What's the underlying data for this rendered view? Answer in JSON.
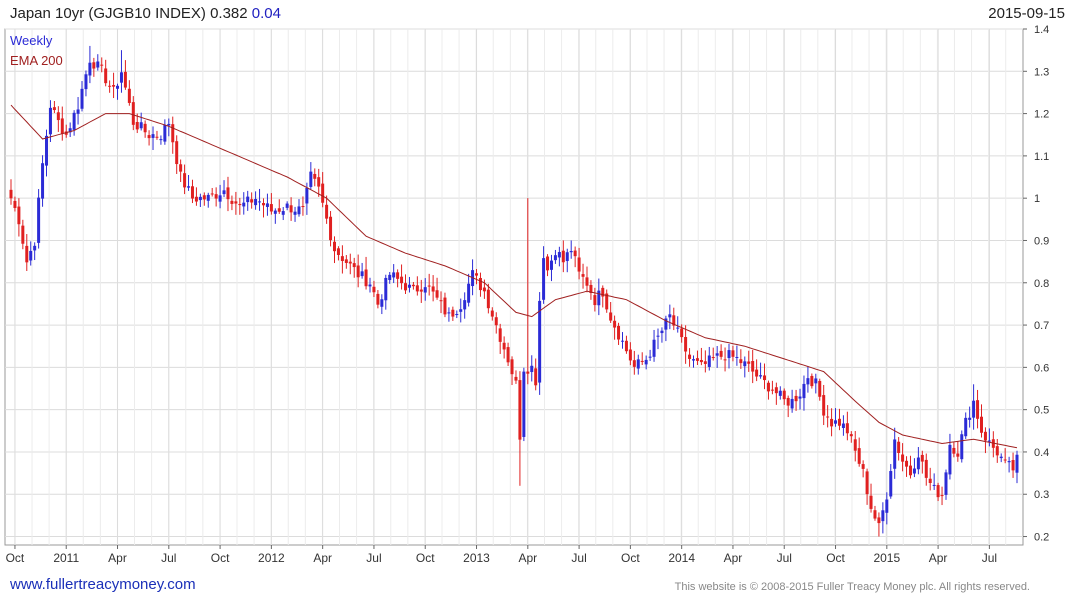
{
  "header": {
    "title": "Japan 10yr (GJGB10 INDEX) 0.382",
    "change": "0.04",
    "date": "2015-09-15"
  },
  "footer": {
    "url": "www.fullertreacymoney.com",
    "copyright": "This website is © 2008-2015 Fuller Treacy Money plc. All rights reserved."
  },
  "colors": {
    "up": "#2b2bd6",
    "down": "#e02020",
    "ema": "#a02020",
    "grid": "#dcdcdc"
  },
  "chart_data": {
    "type": "candlestick",
    "legend": [
      "Weekly",
      "EMA 200"
    ],
    "legend_position": "top-left",
    "y_axis": "right",
    "ylim": [
      0.18,
      1.4
    ],
    "y_ticks": [
      "0.2",
      "0.3",
      "0.4",
      "0.5",
      "0.6",
      "0.7",
      "0.8",
      "0.9",
      "1",
      "1.1",
      "1.2",
      "1.3",
      "1.4"
    ],
    "x_ticks": [
      "Oct",
      "2011",
      "Apr",
      "Jul",
      "Oct",
      "2012",
      "Apr",
      "Jul",
      "Oct",
      "2013",
      "Apr",
      "Jul",
      "Oct",
      "2014",
      "Apr",
      "Jul",
      "Oct",
      "2015",
      "Apr",
      "Jul"
    ],
    "x_tick_weeks": [
      1,
      14,
      27,
      40,
      53,
      66,
      79,
      92,
      105,
      118,
      131,
      144,
      157,
      170,
      183,
      196,
      209,
      222,
      235,
      248
    ],
    "weekly_close_anchors": [
      [
        0,
        1.0
      ],
      [
        2,
        0.95
      ],
      [
        4,
        0.85
      ],
      [
        6,
        0.9
      ],
      [
        8,
        1.08
      ],
      [
        10,
        1.22
      ],
      [
        12,
        1.18
      ],
      [
        14,
        1.15
      ],
      [
        17,
        1.22
      ],
      [
        20,
        1.33
      ],
      [
        23,
        1.3
      ],
      [
        26,
        1.25
      ],
      [
        28,
        1.3
      ],
      [
        31,
        1.18
      ],
      [
        35,
        1.15
      ],
      [
        38,
        1.15
      ],
      [
        40,
        1.18
      ],
      [
        43,
        1.05
      ],
      [
        46,
        1.0
      ],
      [
        50,
        1.0
      ],
      [
        54,
        1.02
      ],
      [
        58,
        0.98
      ],
      [
        62,
        1.0
      ],
      [
        66,
        0.97
      ],
      [
        70,
        0.98
      ],
      [
        74,
        0.97
      ],
      [
        76,
        1.05
      ],
      [
        78,
        1.02
      ],
      [
        80,
        0.95
      ],
      [
        82,
        0.88
      ],
      [
        85,
        0.85
      ],
      [
        88,
        0.82
      ],
      [
        91,
        0.8
      ],
      [
        93,
        0.75
      ],
      [
        96,
        0.82
      ],
      [
        99,
        0.8
      ],
      [
        102,
        0.78
      ],
      [
        105,
        0.8
      ],
      [
        108,
        0.76
      ],
      [
        111,
        0.72
      ],
      [
        114,
        0.75
      ],
      [
        117,
        0.82
      ],
      [
        120,
        0.78
      ],
      [
        123,
        0.7
      ],
      [
        126,
        0.62
      ],
      [
        128,
        0.56
      ],
      [
        129,
        0.44
      ],
      [
        130,
        0.6
      ],
      [
        132,
        0.6
      ],
      [
        133,
        0.57
      ],
      [
        134,
        0.76
      ],
      [
        135,
        0.87
      ],
      [
        136,
        0.83
      ],
      [
        138,
        0.88
      ],
      [
        140,
        0.85
      ],
      [
        142,
        0.88
      ],
      [
        144,
        0.82
      ],
      [
        146,
        0.8
      ],
      [
        148,
        0.76
      ],
      [
        150,
        0.78
      ],
      [
        152,
        0.72
      ],
      [
        154,
        0.68
      ],
      [
        156,
        0.64
      ],
      [
        158,
        0.6
      ],
      [
        161,
        0.62
      ],
      [
        164,
        0.67
      ],
      [
        167,
        0.72
      ],
      [
        169,
        0.68
      ],
      [
        172,
        0.62
      ],
      [
        175,
        0.6
      ],
      [
        178,
        0.62
      ],
      [
        181,
        0.63
      ],
      [
        184,
        0.62
      ],
      [
        187,
        0.6
      ],
      [
        190,
        0.57
      ],
      [
        193,
        0.55
      ],
      [
        196,
        0.52
      ],
      [
        198,
        0.52
      ],
      [
        200,
        0.54
      ],
      [
        202,
        0.58
      ],
      [
        204,
        0.56
      ],
      [
        206,
        0.5
      ],
      [
        208,
        0.47
      ],
      [
        210,
        0.47
      ],
      [
        212,
        0.45
      ],
      [
        214,
        0.4
      ],
      [
        216,
        0.35
      ],
      [
        218,
        0.27
      ],
      [
        220,
        0.22
      ],
      [
        222,
        0.3
      ],
      [
        224,
        0.43
      ],
      [
        226,
        0.38
      ],
      [
        228,
        0.35
      ],
      [
        230,
        0.4
      ],
      [
        232,
        0.34
      ],
      [
        234,
        0.31
      ],
      [
        236,
        0.3
      ],
      [
        238,
        0.42
      ],
      [
        240,
        0.4
      ],
      [
        242,
        0.47
      ],
      [
        244,
        0.52
      ],
      [
        246,
        0.45
      ],
      [
        248,
        0.42
      ],
      [
        250,
        0.4
      ],
      [
        252,
        0.37
      ],
      [
        254,
        0.36
      ],
      [
        255,
        0.38
      ]
    ],
    "ema200_anchors": [
      [
        0,
        1.22
      ],
      [
        8,
        1.14
      ],
      [
        16,
        1.16
      ],
      [
        24,
        1.2
      ],
      [
        30,
        1.2
      ],
      [
        40,
        1.17
      ],
      [
        50,
        1.13
      ],
      [
        60,
        1.09
      ],
      [
        70,
        1.05
      ],
      [
        80,
        1.0
      ],
      [
        90,
        0.91
      ],
      [
        100,
        0.87
      ],
      [
        110,
        0.84
      ],
      [
        120,
        0.8
      ],
      [
        128,
        0.73
      ],
      [
        132,
        0.72
      ],
      [
        138,
        0.76
      ],
      [
        146,
        0.78
      ],
      [
        156,
        0.76
      ],
      [
        166,
        0.71
      ],
      [
        176,
        0.67
      ],
      [
        186,
        0.65
      ],
      [
        196,
        0.62
      ],
      [
        206,
        0.59
      ],
      [
        214,
        0.52
      ],
      [
        220,
        0.47
      ],
      [
        226,
        0.44
      ],
      [
        236,
        0.42
      ],
      [
        244,
        0.43
      ],
      [
        255,
        0.41
      ]
    ],
    "extreme_lows": [
      [
        129,
        0.32
      ],
      [
        220,
        0.2
      ]
    ],
    "extreme_highs": [
      [
        131,
        1.0
      ],
      [
        20,
        1.36
      ],
      [
        28,
        1.35
      ],
      [
        244,
        0.56
      ]
    ]
  }
}
